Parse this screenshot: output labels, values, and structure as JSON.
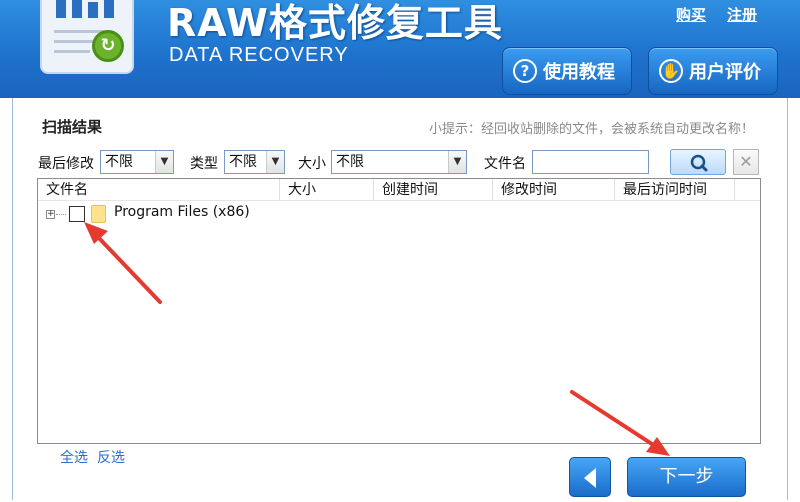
{
  "header": {
    "title": "RAW格式修复工具",
    "subtitle": "DATA RECOVERY",
    "buy_link": "购买",
    "register_link": "注册",
    "tutorial_button": "使用教程",
    "review_button": "用户评价"
  },
  "scan": {
    "title": "扫描结果",
    "tip": "小提示：经回收站删除的文件，会被系统自动更改名称！"
  },
  "filters": {
    "last_modified_label": "最后修改",
    "last_modified_value": "不限",
    "type_label": "类型",
    "type_value": "不限",
    "size_label": "大小",
    "size_value": "不限",
    "filename_label": "文件名",
    "filename_value": ""
  },
  "table": {
    "columns": [
      "文件名",
      "大小",
      "创建时间",
      "修改时间",
      "最后访问时间"
    ],
    "rows": [
      {
        "name": "Program Files (x86)",
        "checked": false
      }
    ]
  },
  "selection": {
    "select_all": "全选",
    "invert": "反选"
  },
  "footer": {
    "next_button": "下一步"
  },
  "icons": {
    "search": "search-icon",
    "clear": "close-icon",
    "back": "arrow-left-icon",
    "help": "question-icon",
    "review": "thumbs-icon"
  },
  "colors": {
    "header_blue": "#1f73cd",
    "accent_blue": "#2a6fd0",
    "annotation_red": "#e53a30"
  }
}
